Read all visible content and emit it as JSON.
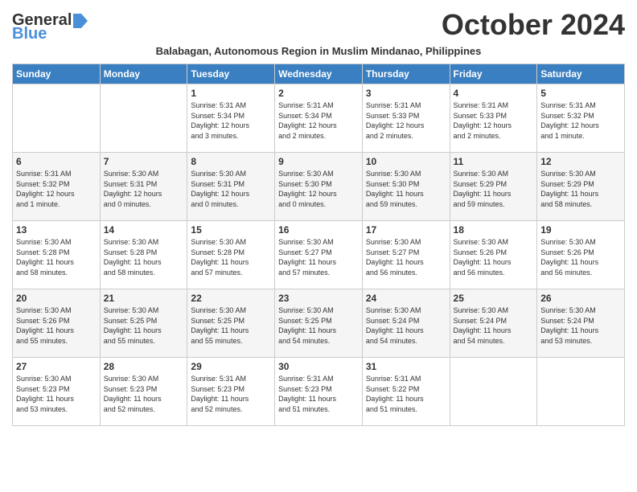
{
  "logo": {
    "name1": "General",
    "name2": "Blue"
  },
  "header": {
    "month_year": "October 2024",
    "subtitle": "Balabagan, Autonomous Region in Muslim Mindanao, Philippines"
  },
  "weekdays": [
    "Sunday",
    "Monday",
    "Tuesday",
    "Wednesday",
    "Thursday",
    "Friday",
    "Saturday"
  ],
  "weeks": [
    [
      {
        "day": "",
        "info": ""
      },
      {
        "day": "",
        "info": ""
      },
      {
        "day": "1",
        "info": "Sunrise: 5:31 AM\nSunset: 5:34 PM\nDaylight: 12 hours\nand 3 minutes."
      },
      {
        "day": "2",
        "info": "Sunrise: 5:31 AM\nSunset: 5:34 PM\nDaylight: 12 hours\nand 2 minutes."
      },
      {
        "day": "3",
        "info": "Sunrise: 5:31 AM\nSunset: 5:33 PM\nDaylight: 12 hours\nand 2 minutes."
      },
      {
        "day": "4",
        "info": "Sunrise: 5:31 AM\nSunset: 5:33 PM\nDaylight: 12 hours\nand 2 minutes."
      },
      {
        "day": "5",
        "info": "Sunrise: 5:31 AM\nSunset: 5:32 PM\nDaylight: 12 hours\nand 1 minute."
      }
    ],
    [
      {
        "day": "6",
        "info": "Sunrise: 5:31 AM\nSunset: 5:32 PM\nDaylight: 12 hours\nand 1 minute."
      },
      {
        "day": "7",
        "info": "Sunrise: 5:30 AM\nSunset: 5:31 PM\nDaylight: 12 hours\nand 0 minutes."
      },
      {
        "day": "8",
        "info": "Sunrise: 5:30 AM\nSunset: 5:31 PM\nDaylight: 12 hours\nand 0 minutes."
      },
      {
        "day": "9",
        "info": "Sunrise: 5:30 AM\nSunset: 5:30 PM\nDaylight: 12 hours\nand 0 minutes."
      },
      {
        "day": "10",
        "info": "Sunrise: 5:30 AM\nSunset: 5:30 PM\nDaylight: 11 hours\nand 59 minutes."
      },
      {
        "day": "11",
        "info": "Sunrise: 5:30 AM\nSunset: 5:29 PM\nDaylight: 11 hours\nand 59 minutes."
      },
      {
        "day": "12",
        "info": "Sunrise: 5:30 AM\nSunset: 5:29 PM\nDaylight: 11 hours\nand 58 minutes."
      }
    ],
    [
      {
        "day": "13",
        "info": "Sunrise: 5:30 AM\nSunset: 5:28 PM\nDaylight: 11 hours\nand 58 minutes."
      },
      {
        "day": "14",
        "info": "Sunrise: 5:30 AM\nSunset: 5:28 PM\nDaylight: 11 hours\nand 58 minutes."
      },
      {
        "day": "15",
        "info": "Sunrise: 5:30 AM\nSunset: 5:28 PM\nDaylight: 11 hours\nand 57 minutes."
      },
      {
        "day": "16",
        "info": "Sunrise: 5:30 AM\nSunset: 5:27 PM\nDaylight: 11 hours\nand 57 minutes."
      },
      {
        "day": "17",
        "info": "Sunrise: 5:30 AM\nSunset: 5:27 PM\nDaylight: 11 hours\nand 56 minutes."
      },
      {
        "day": "18",
        "info": "Sunrise: 5:30 AM\nSunset: 5:26 PM\nDaylight: 11 hours\nand 56 minutes."
      },
      {
        "day": "19",
        "info": "Sunrise: 5:30 AM\nSunset: 5:26 PM\nDaylight: 11 hours\nand 56 minutes."
      }
    ],
    [
      {
        "day": "20",
        "info": "Sunrise: 5:30 AM\nSunset: 5:26 PM\nDaylight: 11 hours\nand 55 minutes."
      },
      {
        "day": "21",
        "info": "Sunrise: 5:30 AM\nSunset: 5:25 PM\nDaylight: 11 hours\nand 55 minutes."
      },
      {
        "day": "22",
        "info": "Sunrise: 5:30 AM\nSunset: 5:25 PM\nDaylight: 11 hours\nand 55 minutes."
      },
      {
        "day": "23",
        "info": "Sunrise: 5:30 AM\nSunset: 5:25 PM\nDaylight: 11 hours\nand 54 minutes."
      },
      {
        "day": "24",
        "info": "Sunrise: 5:30 AM\nSunset: 5:24 PM\nDaylight: 11 hours\nand 54 minutes."
      },
      {
        "day": "25",
        "info": "Sunrise: 5:30 AM\nSunset: 5:24 PM\nDaylight: 11 hours\nand 54 minutes."
      },
      {
        "day": "26",
        "info": "Sunrise: 5:30 AM\nSunset: 5:24 PM\nDaylight: 11 hours\nand 53 minutes."
      }
    ],
    [
      {
        "day": "27",
        "info": "Sunrise: 5:30 AM\nSunset: 5:23 PM\nDaylight: 11 hours\nand 53 minutes."
      },
      {
        "day": "28",
        "info": "Sunrise: 5:30 AM\nSunset: 5:23 PM\nDaylight: 11 hours\nand 52 minutes."
      },
      {
        "day": "29",
        "info": "Sunrise: 5:31 AM\nSunset: 5:23 PM\nDaylight: 11 hours\nand 52 minutes."
      },
      {
        "day": "30",
        "info": "Sunrise: 5:31 AM\nSunset: 5:23 PM\nDaylight: 11 hours\nand 51 minutes."
      },
      {
        "day": "31",
        "info": "Sunrise: 5:31 AM\nSunset: 5:22 PM\nDaylight: 11 hours\nand 51 minutes."
      },
      {
        "day": "",
        "info": ""
      },
      {
        "day": "",
        "info": ""
      }
    ]
  ]
}
